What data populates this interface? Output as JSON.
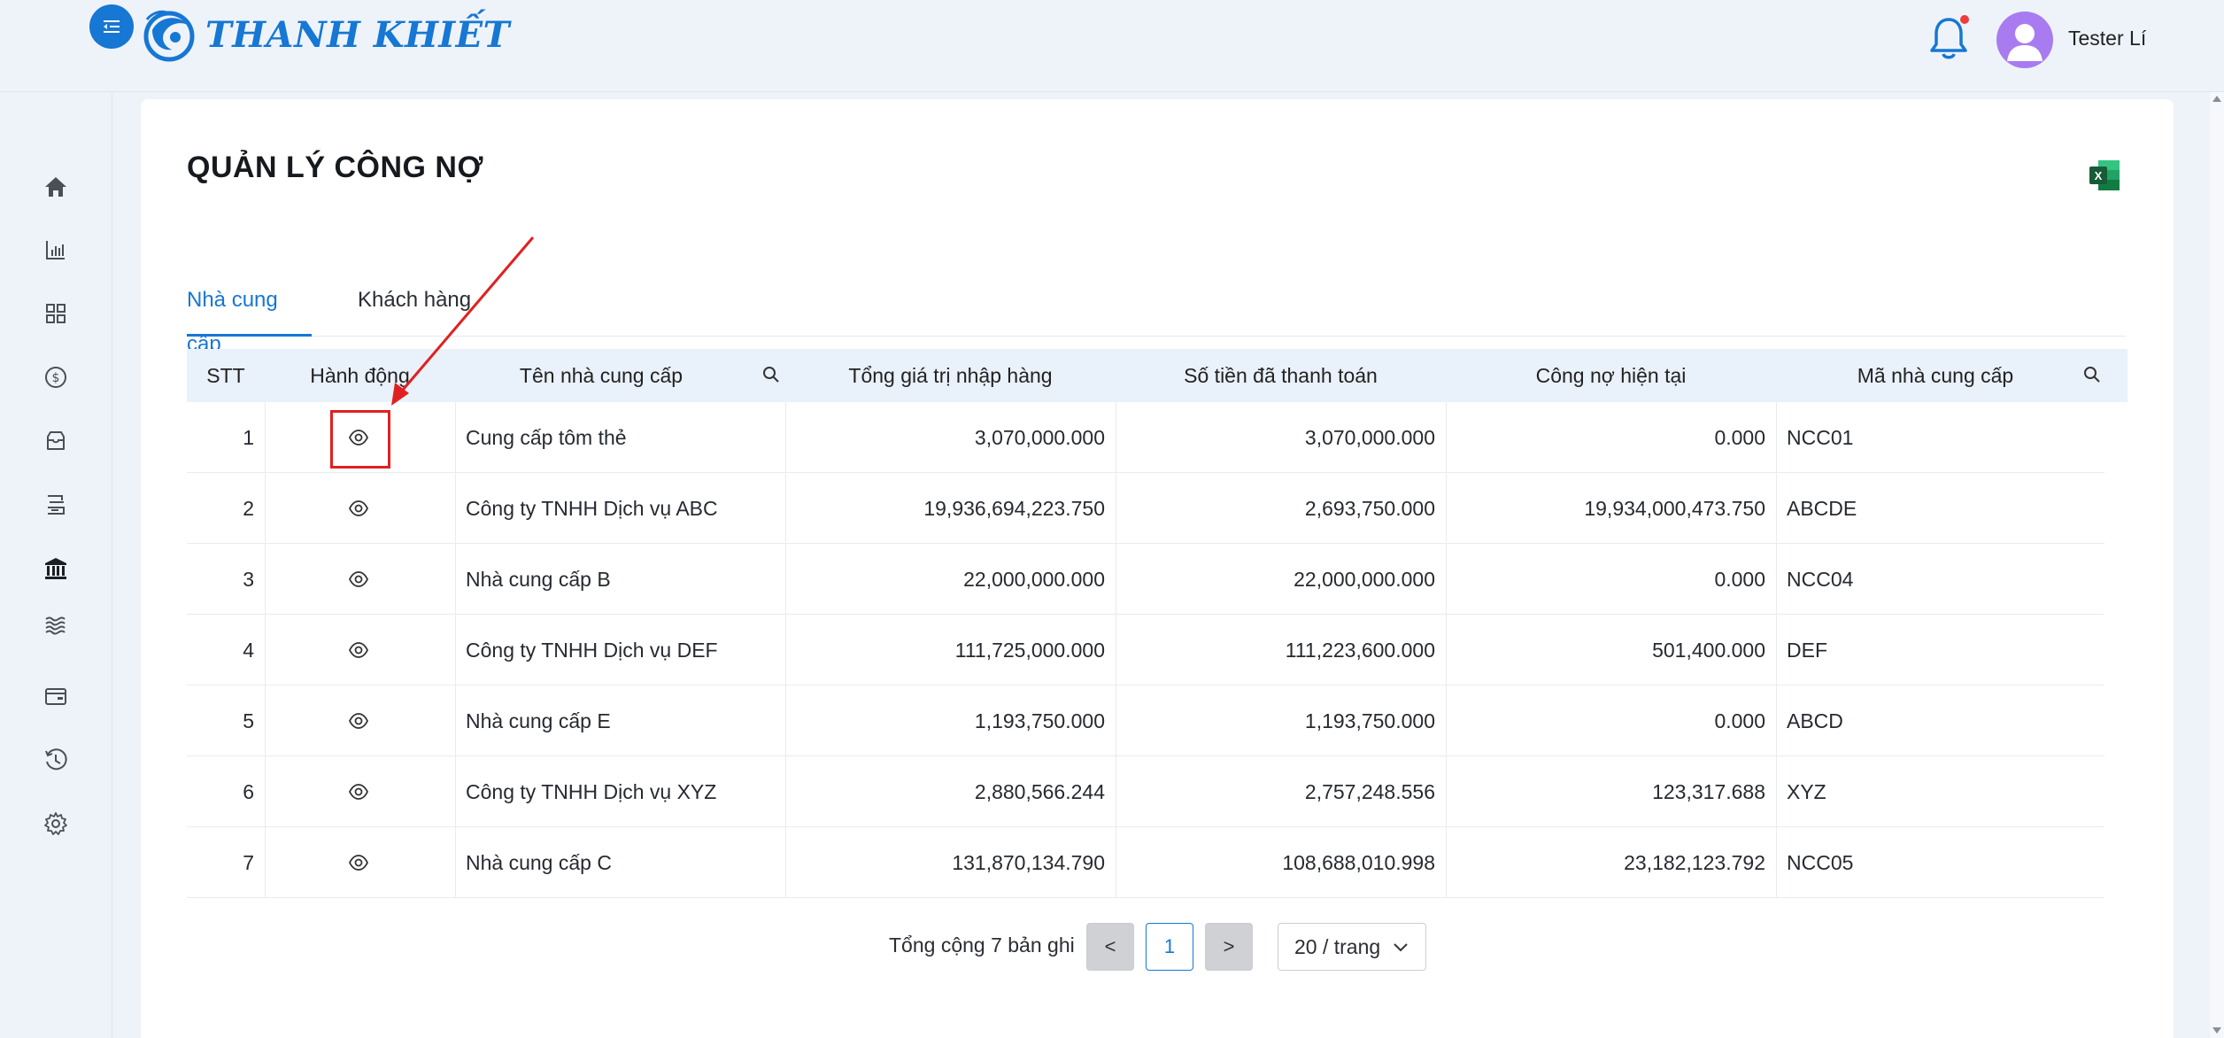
{
  "brand": {
    "name": "THANH KHIẾT",
    "accent_color": "#1677d4"
  },
  "header": {
    "menu_toggle_icon": "menu-fold-icon",
    "notification_icon": "bell-icon",
    "has_unread": true,
    "user_name": "Tester Lí"
  },
  "sidebar": {
    "items": [
      {
        "icon": "home-icon"
      },
      {
        "icon": "bar-chart-icon"
      },
      {
        "icon": "grid-icon"
      },
      {
        "icon": "dollar-icon"
      },
      {
        "icon": "inbox-icon"
      },
      {
        "icon": "transfer-icon"
      },
      {
        "icon": "bank-icon",
        "active": true
      },
      {
        "icon": "waves-icon"
      },
      {
        "icon": "wallet-icon"
      },
      {
        "icon": "history-icon"
      },
      {
        "icon": "settings-icon"
      }
    ]
  },
  "page": {
    "title": "QUẢN LÝ CÔNG NỢ",
    "export_icon": "excel-icon"
  },
  "tabs": [
    {
      "label": "Nhà cung cấp",
      "active": true
    },
    {
      "label": "Khách hàng",
      "active": false
    }
  ],
  "table": {
    "columns": {
      "stt": "STT",
      "action": "Hành động",
      "supplier_name": "Tên nhà cung cấp",
      "total_import": "Tổng giá trị nhập hàng",
      "paid": "Số tiền đã thanh toán",
      "current_debt": "Công nợ hiện tại",
      "supplier_code": "Mã nhà cung cấp"
    },
    "rows": [
      {
        "stt": "1",
        "name": "Cung cấp tôm thẻ",
        "total": "3,070,000.000",
        "paid": "3,070,000.000",
        "debt": "0.000",
        "code": "NCC01"
      },
      {
        "stt": "2",
        "name": "Công ty TNHH Dịch vụ ABC",
        "total": "19,936,694,223.750",
        "paid": "2,693,750.000",
        "debt": "19,934,000,473.750",
        "code": "ABCDE"
      },
      {
        "stt": "3",
        "name": "Nhà cung cấp B",
        "total": "22,000,000.000",
        "paid": "22,000,000.000",
        "debt": "0.000",
        "code": "NCC04"
      },
      {
        "stt": "4",
        "name": "Công ty TNHH Dịch vụ DEF",
        "total": "111,725,000.000",
        "paid": "111,223,600.000",
        "debt": "501,400.000",
        "code": "DEF"
      },
      {
        "stt": "5",
        "name": "Nhà cung cấp E",
        "total": "1,193,750.000",
        "paid": "1,193,750.000",
        "debt": "0.000",
        "code": "ABCD"
      },
      {
        "stt": "6",
        "name": "Công ty TNHH Dịch vụ XYZ",
        "total": "2,880,566.244",
        "paid": "2,757,248.556",
        "debt": "123,317.688",
        "code": "XYZ"
      },
      {
        "stt": "7",
        "name": "Nhà cung cấp C",
        "total": "131,870,134.790",
        "paid": "108,688,010.998",
        "debt": "23,182,123.792",
        "code": "NCC05"
      }
    ]
  },
  "pagination": {
    "total_text": "Tổng cộng 7 bản ghi",
    "prev": "<",
    "current_page": "1",
    "next": ">",
    "page_size": "20 / trang"
  },
  "annotation": {
    "color": "#e02020"
  }
}
